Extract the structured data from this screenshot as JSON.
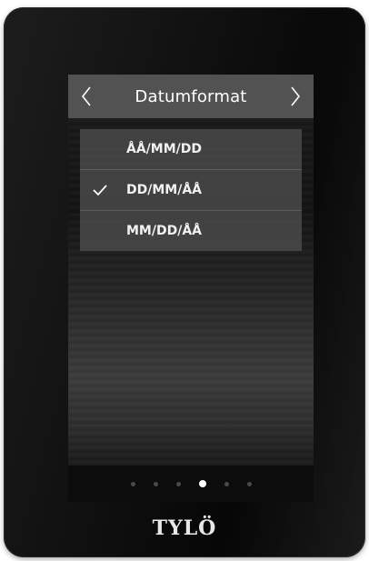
{
  "header": {
    "title": "Datumformat",
    "prev_icon": "chevron-left-icon",
    "next_icon": "chevron-right-icon"
  },
  "options": [
    {
      "label": "ÅÅ/MM/DD",
      "selected": false
    },
    {
      "label": "DD/MM/ÅÅ",
      "selected": true
    },
    {
      "label": "MM/DD/ÅÅ",
      "selected": false
    }
  ],
  "pagination": {
    "total": 6,
    "active_index": 3
  },
  "brand": {
    "logo_text": "TYLÖ"
  },
  "colors": {
    "header_bg": "#555555",
    "option_bg": "#505050",
    "text": "#ffffff",
    "dot_active": "#ffffff",
    "dot_inactive": "#4a4a4a"
  }
}
